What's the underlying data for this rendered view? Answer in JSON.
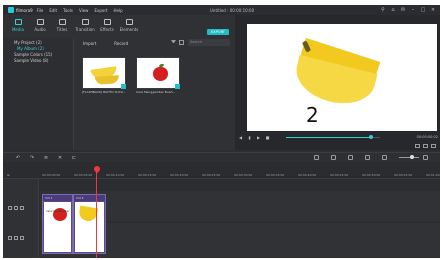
{
  "app": {
    "name": "filmora9",
    "title": "Untitled : 00:00:10:00",
    "menu": [
      "File",
      "Edit",
      "Tools",
      "View",
      "Export",
      "Help"
    ]
  },
  "tabs": [
    {
      "label": "Media",
      "icon": "media-icon"
    },
    {
      "label": "Audio",
      "icon": "audio-icon"
    },
    {
      "label": "Titles",
      "icon": "titles-icon"
    },
    {
      "label": "Transition",
      "icon": "transition-icon"
    },
    {
      "label": "Effects",
      "icon": "effects-icon"
    },
    {
      "label": "Elements",
      "icon": "elements-icon"
    }
  ],
  "export_label": "EXPORT",
  "folders": [
    {
      "label": "My Project (2)"
    },
    {
      "label": "My Album (2)"
    },
    {
      "label": "Sample Colors (15)"
    },
    {
      "label": "Sample Video (8)"
    }
  ],
  "media_toolbar": {
    "import_label": "Import",
    "record_label": "Record",
    "search_placeholder": "Search"
  },
  "media_items": [
    {
      "label": "[FLASHBACK] BAHTO SUCU..."
    },
    {
      "label": "Cara Menggambar Buah..."
    }
  ],
  "preview": {
    "caption_number": "2",
    "time": "00:00:00:02",
    "progress": 0.9
  },
  "timeline": {
    "ruler_ticks": [
      "00:00:00:00",
      "00:00:05:00",
      "00:00:10:00",
      "00:00:15:00",
      "00:00:20:00",
      "00:00:25:00",
      "00:00:30:00",
      "00:00:35:00",
      "00:00:40:00",
      "00:00:45:00",
      "00:00:50:00",
      "00:00:55:00",
      "00:01:00:00"
    ],
    "clips": [
      {
        "label": "Vid 1",
        "inner": "Cara menggambar"
      },
      {
        "label": "Vid 2",
        "inner": ""
      }
    ]
  },
  "colors": {
    "accent": "#1fbec6",
    "playhead": "#ee3a3a",
    "clip": "#5a4a8a"
  }
}
